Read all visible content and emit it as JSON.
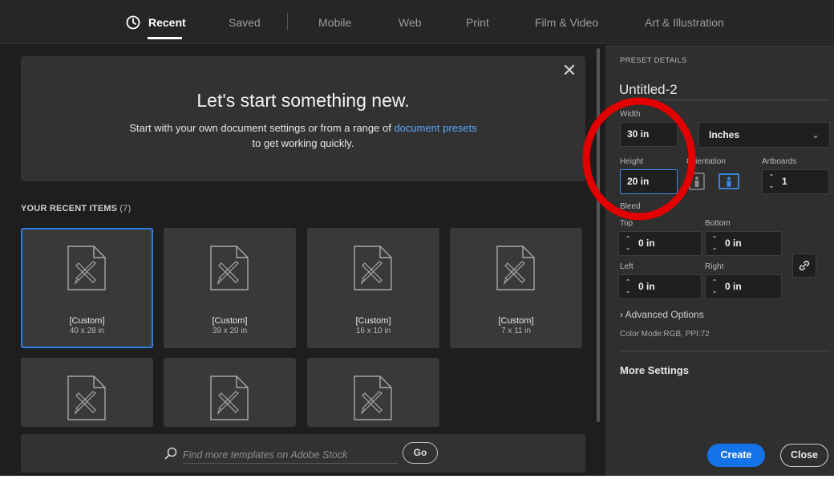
{
  "tabs": [
    {
      "label": "Recent",
      "active": true
    },
    {
      "label": "Saved"
    },
    {
      "label": "Mobile"
    },
    {
      "label": "Web"
    },
    {
      "label": "Print"
    },
    {
      "label": "Film & Video"
    },
    {
      "label": "Art & Illustration"
    }
  ],
  "welcome": {
    "title": "Let's start something new.",
    "sub_prefix": "Start with your own document settings or from a range of ",
    "sub_link": "document presets",
    "sub_suffix": "to get working quickly.",
    "close_glyph": "✕"
  },
  "recent": {
    "label": "YOUR RECENT ITEMS",
    "count": "(7)",
    "items": [
      {
        "name": "[Custom]",
        "size": "40 x 28 in",
        "selected": true
      },
      {
        "name": "[Custom]",
        "size": "39 x 20 in"
      },
      {
        "name": "[Custom]",
        "size": "16 x 10 in"
      },
      {
        "name": "[Custom]",
        "size": "7 x 11 in"
      },
      {
        "name": "",
        "size": ""
      },
      {
        "name": "",
        "size": ""
      },
      {
        "name": "",
        "size": ""
      }
    ]
  },
  "search": {
    "placeholder": "Find more templates on Adobe Stock",
    "go_label": "Go"
  },
  "preset": {
    "section_title": "PRESET DETAILS",
    "doc_name": "Untitled-2",
    "width_label": "Width",
    "width_value": "30 in",
    "units_value": "Inches",
    "height_label": "Height",
    "height_value": "20 in",
    "orientation_label": "Orientation",
    "artboards_label": "Artboards",
    "artboards_value": "1",
    "bleed_label": "Bleed",
    "top_label": "Top",
    "top_value": "0 in",
    "bottom_label": "Bottom",
    "bottom_value": "0 in",
    "left_label": "Left",
    "left_value": "0 in",
    "right_label": "Right",
    "right_value": "0 in",
    "advanced_label": "Advanced Options",
    "color_mode": "Color Mode:RGB, PPI:72",
    "more_settings": "More Settings",
    "create_label": "Create",
    "close_label": "Close"
  },
  "colors": {
    "accent": "#1473e6",
    "focus": "#3d8ce8",
    "annotation": "#e30000",
    "link": "#5aa7ff"
  },
  "icons": {
    "recent_tab": "clock-icon",
    "card": "document-pencil-ruler-icon",
    "search": "search-icon",
    "portrait": "portrait-orientation-icon",
    "landscape": "landscape-orientation-icon",
    "link": "link-icon"
  }
}
